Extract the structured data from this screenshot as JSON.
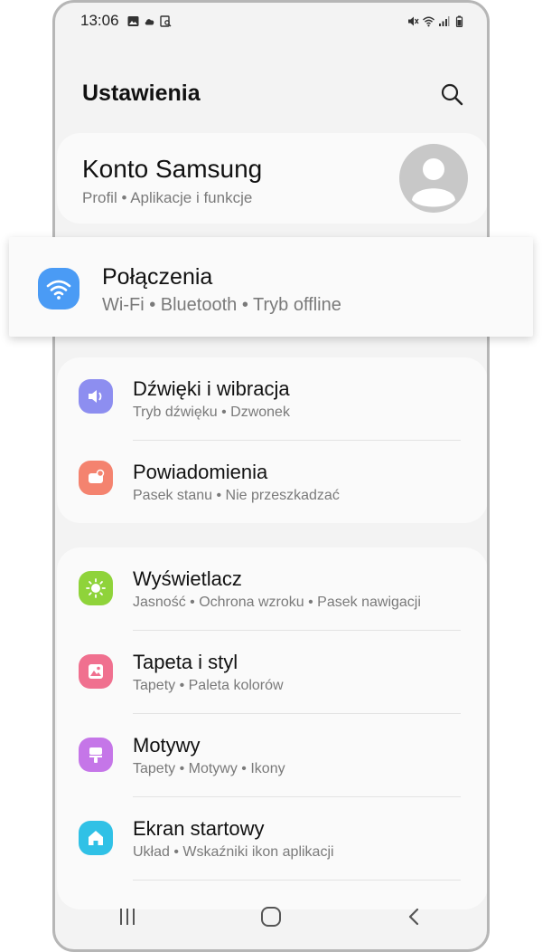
{
  "status_bar": {
    "time": "13:06"
  },
  "header": {
    "title": "Ustawienia"
  },
  "account": {
    "title": "Konto Samsung",
    "subtitle": "Profil  •  Aplikacje i funkcje"
  },
  "highlighted": {
    "title": "Połączenia",
    "subtitle": "Wi-Fi  •  Bluetooth  •  Tryb offline",
    "icon": "wifi-icon",
    "color": "#4a9bf5"
  },
  "group1": [
    {
      "title": "Dźwięki i wibracja",
      "subtitle": "Tryb dźwięku  •  Dzwonek",
      "icon": "sound-icon",
      "color": "#8d8ef0"
    },
    {
      "title": "Powiadomienia",
      "subtitle": "Pasek stanu  •  Nie przeszkadzać",
      "icon": "notification-icon",
      "color": "#f4836f"
    }
  ],
  "group2": [
    {
      "title": "Wyświetlacz",
      "subtitle": "Jasność  •  Ochrona wzroku  •  Pasek nawigacji",
      "icon": "brightness-icon",
      "color": "#8fd33a"
    },
    {
      "title": "Tapeta i styl",
      "subtitle": "Tapety  •  Paleta kolorów",
      "icon": "wallpaper-icon",
      "color": "#f0708f"
    },
    {
      "title": "Motywy",
      "subtitle": "Tapety  •  Motywy  •  Ikony",
      "icon": "themes-icon",
      "color": "#c576e8"
    },
    {
      "title": "Ekran startowy",
      "subtitle": "Układ  •  Wskaźniki ikon aplikacji",
      "icon": "home-icon",
      "color": "#30c1e6"
    }
  ],
  "navbar": {
    "recent": "recent-apps-icon",
    "home": "home-button-icon",
    "back": "back-icon"
  }
}
